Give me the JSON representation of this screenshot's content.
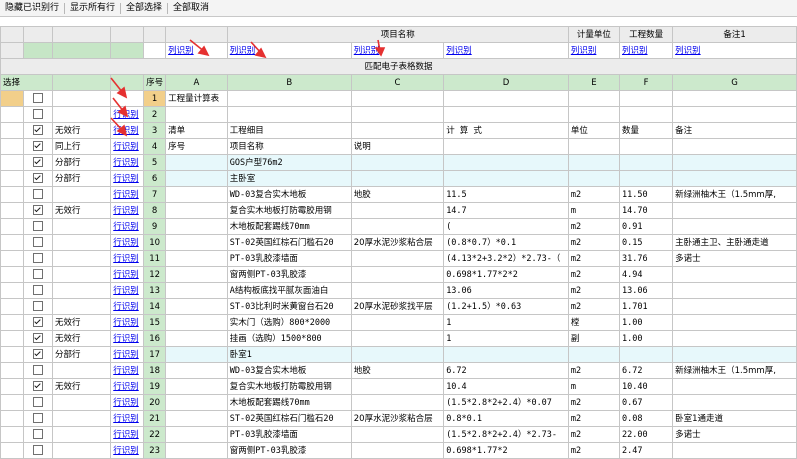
{
  "toolbar": [
    "隐藏已识别行",
    "显示所有行",
    "全部选择",
    "全部取消"
  ],
  "header": {
    "project_name": "项目名称",
    "unit": "计量单位",
    "quantity": "工程数量",
    "remark": "备注1"
  },
  "map_row": {
    "a": "列识别",
    "b": "列识别",
    "c": "列识别",
    "d": "列识别",
    "e": "列识别",
    "f": "列识别",
    "g": "列识别"
  },
  "table_title": "匹配电子表格数据",
  "colhdr": {
    "select": "选择",
    "seq": "序号",
    "a": "A",
    "b": "B",
    "c": "C",
    "d": "D",
    "e": "E",
    "f": "F",
    "g": "G"
  },
  "rows": [
    {
      "n": "1",
      "checked": false,
      "type": "",
      "link": "",
      "a": "工程量计算表",
      "b": "",
      "c": "",
      "d": "",
      "e": "",
      "f": "",
      "g": ""
    },
    {
      "n": "2",
      "checked": false,
      "type": "",
      "link": "行识别",
      "a": "",
      "b": "",
      "c": "",
      "d": "",
      "e": "",
      "f": "",
      "g": ""
    },
    {
      "n": "3",
      "checked": true,
      "type": "无效行",
      "link": "行识别",
      "a": "清单",
      "b": "工程细目",
      "c": "",
      "d": "计 算 式",
      "e": "单位",
      "f": "数量",
      "g": "备注"
    },
    {
      "n": "4",
      "checked": true,
      "type": "同上行",
      "link": "行识别",
      "a": "序号",
      "b": "项目名称",
      "c": "说明",
      "d": "",
      "e": "",
      "f": "",
      "g": ""
    },
    {
      "n": "5",
      "checked": true,
      "type": "分部行",
      "link": "行识别",
      "a": "",
      "b": "GOS户型76m2",
      "c": "",
      "d": "",
      "e": "",
      "f": "",
      "g": ""
    },
    {
      "n": "6",
      "checked": true,
      "type": "分部行",
      "link": "行识别",
      "a": "",
      "b": "主卧室",
      "c": "",
      "d": "",
      "e": "",
      "f": "",
      "g": ""
    },
    {
      "n": "7",
      "checked": false,
      "type": "",
      "link": "行识别",
      "a": "",
      "b": "WD-03复合实木地板",
      "c": "地胶",
      "d": "11.5",
      "e": "m2",
      "f": "11.50",
      "g": "新绿洲柚木王（1.5mm厚,"
    },
    {
      "n": "8",
      "checked": true,
      "type": "无效行",
      "link": "行识别",
      "a": "",
      "b": "复合实木地板打防霉胶用钢",
      "c": "",
      "d": "14.7",
      "e": "m",
      "f": "14.70",
      "g": ""
    },
    {
      "n": "9",
      "checked": false,
      "type": "",
      "link": "行识别",
      "a": "",
      "b": "木地板配套踢线70mm",
      "c": "",
      "d": "(",
      "e": "m2",
      "f": "0.91",
      "g": ""
    },
    {
      "n": "10",
      "checked": false,
      "type": "",
      "link": "行识别",
      "a": "",
      "b": "ST-02英国红棕石门槛石20",
      "c": "20厚水泥沙浆粘合层",
      "d": "(0.8*0.7）*0.1",
      "e": "m2",
      "f": "0.15",
      "g": "主卧通主卫、主卧通走道"
    },
    {
      "n": "11",
      "checked": false,
      "type": "",
      "link": "行识别",
      "a": "",
      "b": "PT-03乳胶漆墙面",
      "c": "",
      "d": "(4.13*2+3.2*2）*2.73-（",
      "e": "m2",
      "f": "31.76",
      "g": "多诺士"
    },
    {
      "n": "12",
      "checked": false,
      "type": "",
      "link": "行识别",
      "a": "",
      "b": "窗两侧PT-03乳胶漆",
      "c": "",
      "d": "0.698*1.77*2*2",
      "e": "m2",
      "f": "4.94",
      "g": ""
    },
    {
      "n": "13",
      "checked": false,
      "type": "",
      "link": "行识别",
      "a": "",
      "b": "A结构板底找平腻灰面油白",
      "c": "",
      "d": "13.06",
      "e": "m2",
      "f": "13.06",
      "g": ""
    },
    {
      "n": "14",
      "checked": false,
      "type": "",
      "link": "行识别",
      "a": "",
      "b": "ST-03比利时米黄窗台石20",
      "c": "20厚水泥砂浆找平层",
      "d": "(1.2+1.5）*0.63",
      "e": "m2",
      "f": "1.701",
      "g": ""
    },
    {
      "n": "15",
      "checked": true,
      "type": "无效行",
      "link": "行识别",
      "a": "",
      "b": "实木门（选购）800*2000",
      "c": "",
      "d": "1",
      "e": "樘",
      "f": "1.00",
      "g": ""
    },
    {
      "n": "16",
      "checked": true,
      "type": "无效行",
      "link": "行识别",
      "a": "",
      "b": "挂画（选购）1500*800",
      "c": "",
      "d": "1",
      "e": "副",
      "f": "1.00",
      "g": ""
    },
    {
      "n": "17",
      "checked": true,
      "type": "分部行",
      "link": "行识别",
      "a": "",
      "b": "卧室1",
      "c": "",
      "d": "",
      "e": "",
      "f": "",
      "g": ""
    },
    {
      "n": "18",
      "checked": false,
      "type": "",
      "link": "行识别",
      "a": "",
      "b": "WD-03复合实木地板",
      "c": "地胶",
      "d": "6.72",
      "e": "m2",
      "f": "6.72",
      "g": "新绿洲柚木王（1.5mm厚,"
    },
    {
      "n": "19",
      "checked": true,
      "type": "无效行",
      "link": "行识别",
      "a": "",
      "b": "复合实木地板打防霉胶用钢",
      "c": "",
      "d": "10.4",
      "e": "m",
      "f": "10.40",
      "g": ""
    },
    {
      "n": "20",
      "checked": false,
      "type": "",
      "link": "行识别",
      "a": "",
      "b": "木地板配套踢线70mm",
      "c": "",
      "d": "(1.5*2.8*2+2.4）*0.07",
      "e": "m2",
      "f": "0.67",
      "g": ""
    },
    {
      "n": "21",
      "checked": false,
      "type": "",
      "link": "行识别",
      "a": "",
      "b": "ST-02英国红棕石门槛石20",
      "c": "20厚水泥沙浆粘合层",
      "d": "0.8*0.1",
      "e": "m2",
      "f": "0.08",
      "g": "卧室1通走道"
    },
    {
      "n": "22",
      "checked": false,
      "type": "",
      "link": "行识别",
      "a": "",
      "b": "PT-03乳胶漆墙面",
      "c": "",
      "d": "(1.5*2.8*2+2.4）*2.73-",
      "e": "m2",
      "f": "22.00",
      "g": "多诺士"
    },
    {
      "n": "23",
      "checked": false,
      "type": "",
      "link": "行识别",
      "a": "",
      "b": "窗两侧PT-03乳胶漆",
      "c": "",
      "d": "0.698*1.77*2",
      "e": "m2",
      "f": "2.47",
      "g": ""
    }
  ],
  "colors": {
    "grid_green": "#c6e6c6",
    "section_cyan": "#e7f8fb",
    "current_orange": "#f2cf8a",
    "link_blue": "#0000ee",
    "arrow_red": "#e53030"
  }
}
